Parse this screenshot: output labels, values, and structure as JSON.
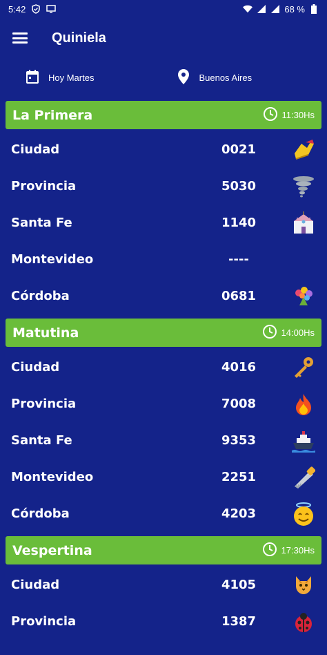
{
  "status_bar": {
    "time": "5:42",
    "battery": "68 %"
  },
  "appbar": {
    "title": "Quiniela"
  },
  "filters": {
    "day_label": "Hoy Martes",
    "location_label": "Buenos Aires"
  },
  "sections": [
    {
      "name": "La Primera",
      "time": "11:30Hs",
      "rows": [
        {
          "prov": "Ciudad",
          "num": "0021",
          "icon": "running-shoe-icon"
        },
        {
          "prov": "Provincia",
          "num": "5030",
          "icon": "tornado-icon"
        },
        {
          "prov": "Santa Fe",
          "num": "1140",
          "icon": "church-icon"
        },
        {
          "prov": "Montevideo",
          "num": "----",
          "icon": ""
        },
        {
          "prov": "Córdoba",
          "num": "0681",
          "icon": "bouquet-icon"
        }
      ]
    },
    {
      "name": "Matutina",
      "time": "14:00Hs",
      "rows": [
        {
          "prov": "Ciudad",
          "num": "4016",
          "icon": "key-icon"
        },
        {
          "prov": "Provincia",
          "num": "7008",
          "icon": "fire-icon"
        },
        {
          "prov": "Santa Fe",
          "num": "9353",
          "icon": "ship-icon"
        },
        {
          "prov": "Montevideo",
          "num": "2251",
          "icon": "saw-icon"
        },
        {
          "prov": "Córdoba",
          "num": "4203",
          "icon": "angel-face-icon"
        }
      ]
    },
    {
      "name": "Vespertina",
      "time": "17:30Hs",
      "rows": [
        {
          "prov": "Ciudad",
          "num": "4105",
          "icon": "cat-icon"
        },
        {
          "prov": "Provincia",
          "num": "1387",
          "icon": "ladybug-icon"
        }
      ]
    }
  ]
}
